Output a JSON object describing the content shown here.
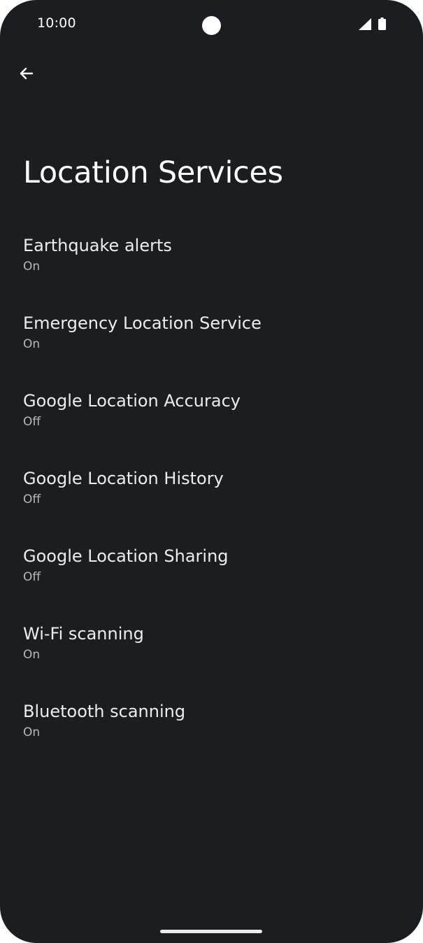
{
  "status_bar": {
    "time": "10:00",
    "signal_icon": "cellular-signal-icon",
    "battery_icon": "battery-full-icon"
  },
  "toolbar": {
    "back_icon": "arrow-back-icon"
  },
  "page": {
    "title": "Location Services"
  },
  "items": [
    {
      "title": "Earthquake alerts",
      "summary": "On"
    },
    {
      "title": "Emergency Location Service",
      "summary": "On"
    },
    {
      "title": "Google Location Accuracy",
      "summary": "Off"
    },
    {
      "title": "Google Location History",
      "summary": "Off"
    },
    {
      "title": "Google Location Sharing",
      "summary": "Off"
    },
    {
      "title": "Wi-Fi scanning",
      "summary": "On"
    },
    {
      "title": "Bluetooth scanning",
      "summary": "On"
    }
  ],
  "colors": {
    "background": "#1b1e21",
    "title_text": "#ffffff",
    "item_title": "#ececec",
    "item_summary": "#b6b9bc"
  }
}
